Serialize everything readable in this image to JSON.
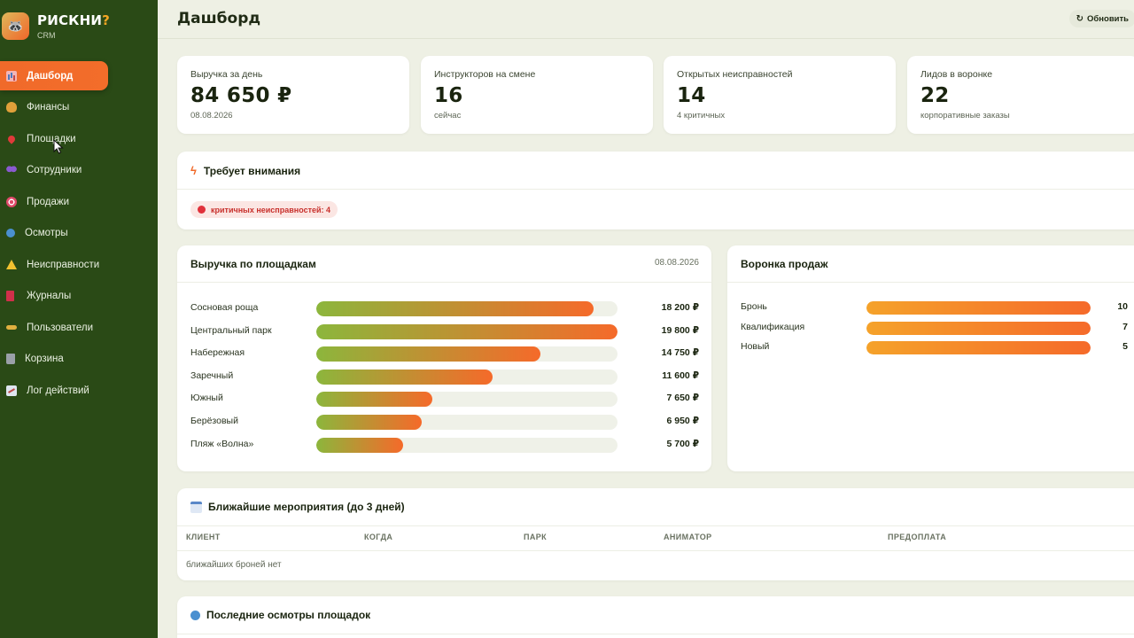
{
  "brand": {
    "name": "РИСКНИ",
    "accent": "?",
    "subtitle": "CRM"
  },
  "nav": [
    {
      "label": "Дашборд",
      "icon": "chart-icon",
      "active": true
    },
    {
      "label": "Финансы",
      "icon": "money-bag-icon"
    },
    {
      "label": "Площадки",
      "icon": "pin-icon"
    },
    {
      "label": "Сотрудники",
      "icon": "people-icon"
    },
    {
      "label": "Продажи",
      "icon": "target-icon"
    },
    {
      "label": "Осмотры",
      "icon": "magnifier-icon"
    },
    {
      "label": "Неисправности",
      "icon": "warning-icon"
    },
    {
      "label": "Журналы",
      "icon": "book-icon"
    },
    {
      "label": "Пользователи",
      "icon": "key-icon"
    },
    {
      "label": "Корзина",
      "icon": "trash-icon"
    },
    {
      "label": "Лог действий",
      "icon": "trend-chart-icon"
    }
  ],
  "header": {
    "title": "Дашборд",
    "refresh_icon": "↻",
    "refresh_label": "Обновить"
  },
  "kpis": [
    {
      "label": "Выручка за день",
      "value": "84 650 ₽",
      "sub": "08.08.2026"
    },
    {
      "label": "Инструкторов на смене",
      "value": "16",
      "sub": "сейчас"
    },
    {
      "label": "Открытых неисправностей",
      "value": "14",
      "sub": "4 критичных"
    },
    {
      "label": "Лидов в воронке",
      "value": "22",
      "sub": "корпоративные заказы"
    }
  ],
  "attention": {
    "title": "Требует внимания",
    "icon": "lightning-icon",
    "alert": "критичных неисправностей: 4"
  },
  "revenue": {
    "title": "Выручка по площадкам",
    "date": "08.08.2026",
    "max": 19800,
    "rows": [
      {
        "label": "Сосновая роща",
        "value": 18200,
        "display": "18 200 ₽"
      },
      {
        "label": "Центральный парк",
        "value": 19800,
        "display": "19 800 ₽"
      },
      {
        "label": "Набережная",
        "value": 14750,
        "display": "14 750 ₽"
      },
      {
        "label": "Заречный",
        "value": 11600,
        "display": "11 600 ₽"
      },
      {
        "label": "Южный",
        "value": 7650,
        "display": "7 650 ₽"
      },
      {
        "label": "Берёзовый",
        "value": 6950,
        "display": "6 950 ₽"
      },
      {
        "label": "Пляж «Волна»",
        "value": 5700,
        "display": "5 700 ₽"
      }
    ],
    "colors": {
      "start": "#8cb63c",
      "end": "#f56a2a"
    }
  },
  "funnel": {
    "title": "Воронка продаж",
    "rows": [
      {
        "label": "Бронь",
        "value": "10",
        "fill": 1.0
      },
      {
        "label": "Квалификация",
        "value": "7",
        "fill": 1.0
      },
      {
        "label": "Новый",
        "value": "5",
        "fill": 1.0
      }
    ]
  },
  "events": {
    "title": "Ближайшие мероприятия (до 3 дней)",
    "icon": "calendar-icon",
    "columns": [
      "КЛИЕНТ",
      "КОГДА",
      "ПАРК",
      "АНИМАТОР",
      "ПРЕДОПЛАТА"
    ],
    "empty": "ближайших броней нет"
  },
  "inspections": {
    "title": "Последние осмотры площадок",
    "icon": "magnifier-icon"
  }
}
